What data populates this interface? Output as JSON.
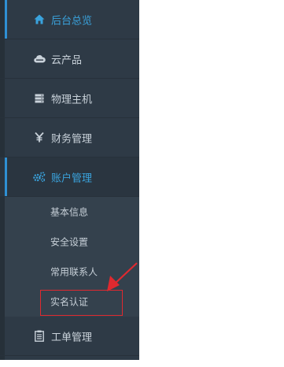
{
  "sidebar": {
    "items": [
      {
        "label": "后台总览",
        "icon": "home-icon",
        "active": true
      },
      {
        "label": "云产品",
        "icon": "cloud-icon"
      },
      {
        "label": "物理主机",
        "icon": "server-icon"
      },
      {
        "label": "财务管理",
        "icon": "yen-icon"
      },
      {
        "label": "账户管理",
        "icon": "gears-icon",
        "expanded": true,
        "children": [
          {
            "label": "基本信息"
          },
          {
            "label": "安全设置"
          },
          {
            "label": "常用联系人"
          },
          {
            "label": "实名认证",
            "highlighted": true
          }
        ]
      },
      {
        "label": "工单管理",
        "icon": "clipboard-icon"
      }
    ]
  },
  "colors": {
    "sidebar_bg": "#2e3a46",
    "submenu_bg": "#34414d",
    "accent": "#2f90d4",
    "active_text": "#3aa3dd",
    "highlight": "#e0292f"
  }
}
